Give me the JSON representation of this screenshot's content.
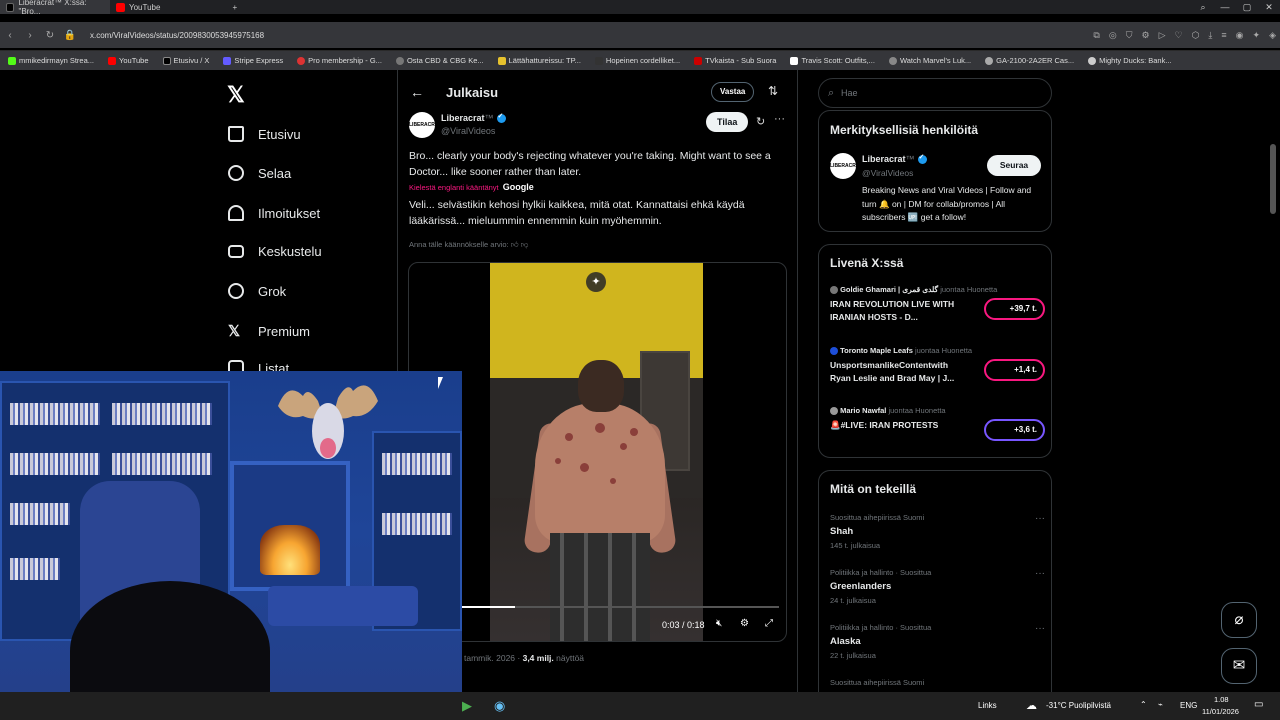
{
  "browser": {
    "tabs": [
      {
        "label": "Liberacrat™ X:ssä: \"Bro...",
        "active": true
      },
      {
        "label": "YouTube",
        "active": false
      }
    ],
    "new_tab": "+",
    "url": "x.com/ViralVideos/status/2009830053945975168",
    "bookmarks": [
      "mmikedirmayn Strea...",
      "YouTube",
      "Etusivu / X",
      "Stripe Express",
      "Pro membership - G...",
      "Osta CBD & CBG Ke...",
      "Lättähattureissu: TP...",
      "Hopeinen cordelliket...",
      "TVkaista - Sub Suora",
      "Travis Scott: Outfits,...",
      "Watch Marvel's Luk...",
      "GA-2100-2A2ER Cas...",
      "Mighty Ducks: Bank..."
    ]
  },
  "sidebar": {
    "items": [
      {
        "label": "Etusivu"
      },
      {
        "label": "Selaa"
      },
      {
        "label": "Ilmoitukset"
      },
      {
        "label": "Keskustelu"
      },
      {
        "label": "Grok"
      },
      {
        "label": "Premium"
      },
      {
        "label": "Listat"
      }
    ]
  },
  "post": {
    "header_title": "Julkaisu",
    "reply_button": "Vastaa",
    "author_name": "Liberacrat",
    "author_tm": "™",
    "author_handle": "@ViralVideos",
    "subscribe_button": "Tilaa",
    "text": "Bro... clearly your body's rejecting whatever you're taking. Might want to see a Doctor... like sooner rather than later.",
    "translated_from": "Kielestä englanti kääntänyt",
    "translator": "Google",
    "translation": "Veli... selvästikin kehosi hylkii kaikkea, mitä otat. Kannattaisi ehkä käydä lääkärissä... mieluummin ennemmin kuin myöhemmin.",
    "rate_translation": "Anna tälle käännökselle arvio:",
    "video_time": "0:03 / 0:18",
    "video_progress": 0.17,
    "date_partial": "tammik. 2026 ·",
    "views": "3,4 milj.",
    "views_suffix": "näyttöä"
  },
  "right": {
    "search_placeholder": "Hae",
    "who_title": "Merkityksellisiä henkilöitä",
    "who_name": "Liberacrat",
    "who_tm": "™",
    "who_handle": "@ViralVideos",
    "follow_button": "Seuraa",
    "who_bio": "Breaking News and Viral Videos | Follow and turn 🔔 on | DM for collab/promos | All subscribers 🆙 get a follow!",
    "live_title": "Livenä X:ssä",
    "live": [
      {
        "source": "Goldie Ghamari | گلدی قمری",
        "suffix": "juontaa Huonetta",
        "title": "IRAN REVOLUTION LIVE WITH IRANIAN HOSTS - D...",
        "count": "+39,7 t."
      },
      {
        "source": "Toronto Maple Leafs",
        "suffix": "juontaa Huonetta",
        "title": "UnsportsmanlikeContentwith Ryan Leslie and Brad May | J...",
        "count": "+1,4 t."
      },
      {
        "source": "Mario Nawfal",
        "suffix": "juontaa Huonetta",
        "title": "🚨#LIVE: IRAN PROTESTS",
        "count": "+3,6 t."
      }
    ],
    "trends_title": "Mitä on tekeillä",
    "trends": [
      {
        "context": "Suosittua aihepiirissä Suomi",
        "title": "Shah",
        "count": "145 t. julkaisua"
      },
      {
        "context": "Politiikka ja hallinto · Suosittua",
        "title": "Greenlanders",
        "count": "24 t. julkaisua"
      },
      {
        "context": "Politiikka ja hallinto · Suosittua",
        "title": "Alaska",
        "count": "22 t. julkaisua"
      },
      {
        "context": "Suosittua aihepiirissä Suomi",
        "title": "",
        "count": ""
      }
    ]
  },
  "taskbar": {
    "links": "Links",
    "weather": "-31°C  Puolipilvistä",
    "lang": "ENG",
    "time": "1.08",
    "date": "11/01/2026"
  },
  "colors": {
    "accent": "#1d9bf0",
    "pink": "#f91880",
    "bg": "#000000"
  }
}
